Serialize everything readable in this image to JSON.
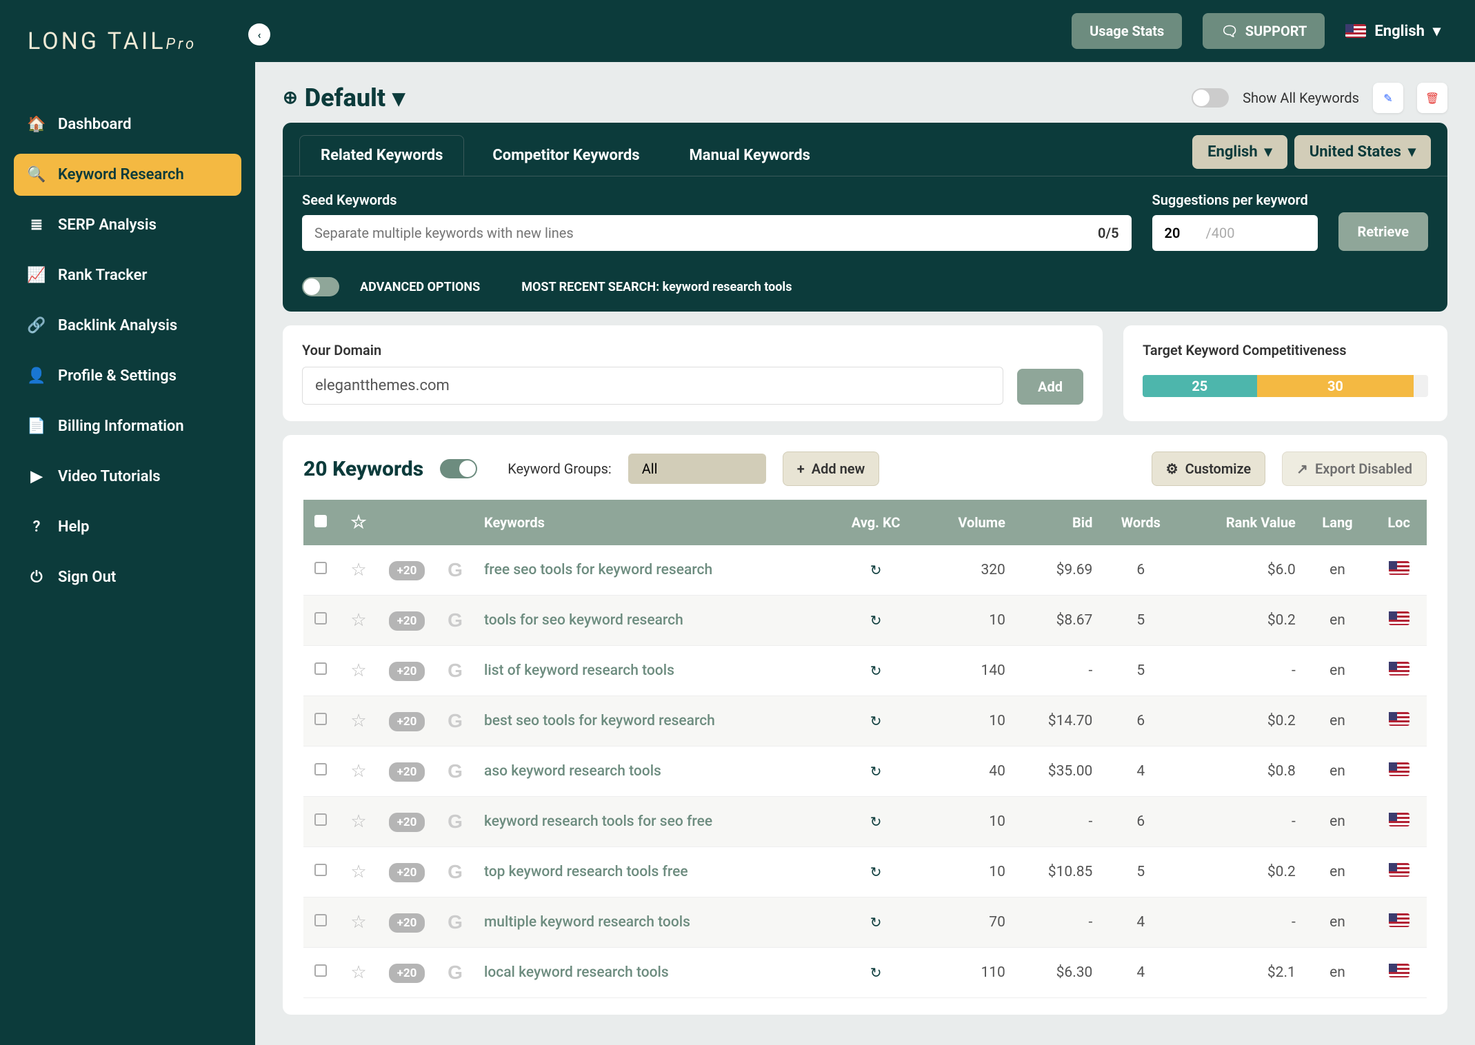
{
  "brand": {
    "name": "LONG TAIL",
    "suffix": "Pro"
  },
  "topbar": {
    "usage": "Usage Stats",
    "support": "SUPPORT",
    "lang": "English"
  },
  "nav": [
    {
      "label": "Dashboard",
      "icon": "🏠"
    },
    {
      "label": "Keyword Research",
      "icon": "🔍",
      "active": true
    },
    {
      "label": "SERP Analysis",
      "icon": "≣"
    },
    {
      "label": "Rank Tracker",
      "icon": "📈"
    },
    {
      "label": "Backlink Analysis",
      "icon": "🔗"
    },
    {
      "label": "Profile & Settings",
      "icon": "👤"
    },
    {
      "label": "Billing Information",
      "icon": "📄"
    },
    {
      "label": "Video Tutorials",
      "icon": "▶"
    },
    {
      "label": "Help",
      "icon": "?"
    },
    {
      "label": "Sign Out",
      "icon": "⏻"
    }
  ],
  "project": {
    "name": "Default",
    "showAll": "Show All Keywords"
  },
  "tabs": {
    "t1": "Related Keywords",
    "t2": "Competitor Keywords",
    "t3": "Manual Keywords",
    "langSel": "English",
    "locSel": "United States"
  },
  "seed": {
    "label": "Seed Keywords",
    "placeholder": "Separate multiple keywords with new lines",
    "counter": "0/5"
  },
  "sugg": {
    "label": "Suggestions per keyword",
    "value": "20",
    "max": "/400"
  },
  "retrieve": "Retrieve",
  "adv": {
    "label": "ADVANCED OPTIONS",
    "recent": "MOST RECENT SEARCH: keyword research tools"
  },
  "domain": {
    "label": "Your Domain",
    "value": "elegantthemes.com",
    "add": "Add"
  },
  "tkc": {
    "label": "Target Keyword Competitiveness",
    "seg1": "25",
    "seg2": "30"
  },
  "kwhead": {
    "count": "20 Keywords",
    "groups": "Keyword Groups:",
    "all": "All",
    "addnew": "Add new",
    "customize": "Customize",
    "export": "Export Disabled"
  },
  "cols": {
    "kw": "Keywords",
    "kc": "Avg. KC",
    "vol": "Volume",
    "bid": "Bid",
    "words": "Words",
    "rank": "Rank Value",
    "lang": "Lang",
    "loc": "Loc"
  },
  "badge": "+20",
  "rows": [
    {
      "kw": "free seo tools for keyword research",
      "vol": "320",
      "bid": "$9.69",
      "words": "6",
      "rank": "$6.0",
      "lang": "en"
    },
    {
      "kw": "tools for seo keyword research",
      "vol": "10",
      "bid": "$8.67",
      "words": "5",
      "rank": "$0.2",
      "lang": "en"
    },
    {
      "kw": "list of keyword research tools",
      "vol": "140",
      "bid": "-",
      "words": "5",
      "rank": "-",
      "lang": "en"
    },
    {
      "kw": "best seo tools for keyword research",
      "vol": "10",
      "bid": "$14.70",
      "words": "6",
      "rank": "$0.2",
      "lang": "en"
    },
    {
      "kw": "aso keyword research tools",
      "vol": "40",
      "bid": "$35.00",
      "words": "4",
      "rank": "$0.8",
      "lang": "en"
    },
    {
      "kw": "keyword research tools for seo free",
      "vol": "10",
      "bid": "-",
      "words": "6",
      "rank": "-",
      "lang": "en"
    },
    {
      "kw": "top keyword research tools free",
      "vol": "10",
      "bid": "$10.85",
      "words": "5",
      "rank": "$0.2",
      "lang": "en"
    },
    {
      "kw": "multiple keyword research tools",
      "vol": "70",
      "bid": "-",
      "words": "4",
      "rank": "-",
      "lang": "en"
    },
    {
      "kw": "local keyword research tools",
      "vol": "110",
      "bid": "$6.30",
      "words": "4",
      "rank": "$2.1",
      "lang": "en"
    }
  ]
}
